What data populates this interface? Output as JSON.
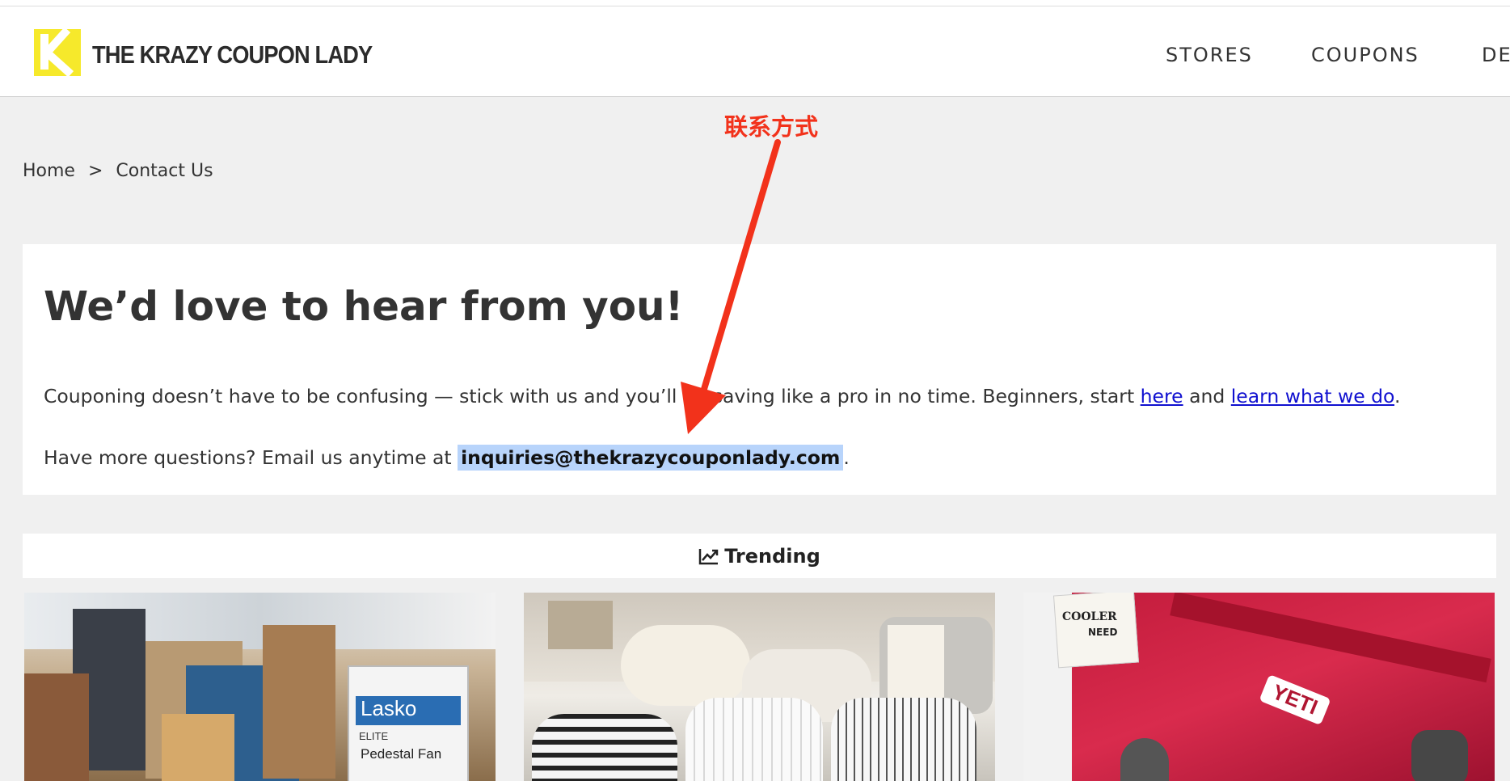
{
  "header": {
    "logo_text": "THE KRAZY COUPON LADY",
    "nav": [
      "STORES",
      "COUPONS",
      "DE"
    ]
  },
  "breadcrumb": {
    "home": "Home",
    "separator": ">",
    "current": "Contact Us"
  },
  "contact": {
    "title": "We’d love to hear from you!",
    "para1_before": "Couponing doesn’t have to be confusing — stick with us and you’ll be saving like a pro in no time. Beginners, start ",
    "link_here": "here",
    "para1_mid": " and ",
    "link_learn": "learn what we do",
    "para1_end": ".",
    "para2_before": "Have more questions? Email us anytime at ",
    "email": "inquiries@thekrazycouponlady.com",
    "para2_end": "."
  },
  "trending": {
    "label": "Trending",
    "icon": "chart-line-icon"
  },
  "thumbnails": {
    "box_brand": "Lasko",
    "box_sub": "ELITE",
    "box_product": "Pedestal Fan",
    "cooler_tag_1": "COOLER",
    "cooler_tag_2": "NEED",
    "cooler_brand": "YETI"
  },
  "annotation": {
    "text": "联系方式",
    "color": "#f2321b"
  },
  "colors": {
    "logo_yellow": "#f6e92b",
    "link": "#1010d0",
    "selection": "#b8d4fb"
  }
}
